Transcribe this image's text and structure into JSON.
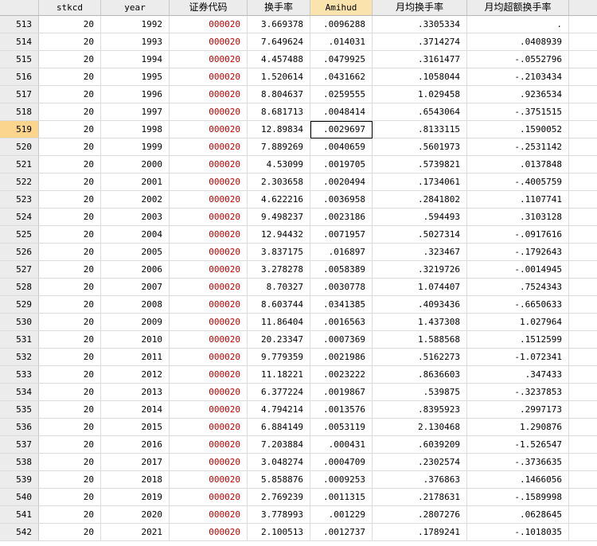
{
  "columns": [
    "stkcd",
    "year",
    "证券代码",
    "换手率",
    "Amihud",
    "月均换手率",
    "月均超额换手率"
  ],
  "selected_column": 4,
  "current_row": "519",
  "rows": [
    {
      "n": "513",
      "stkcd": "20",
      "year": "1992",
      "code": "000020",
      "turnover": "3.669378",
      "amihud": ".0096288",
      "mturn": ".3305334",
      "mexcess": "."
    },
    {
      "n": "514",
      "stkcd": "20",
      "year": "1993",
      "code": "000020",
      "turnover": "7.649624",
      "amihud": ".014031",
      "mturn": ".3714274",
      "mexcess": ".0408939"
    },
    {
      "n": "515",
      "stkcd": "20",
      "year": "1994",
      "code": "000020",
      "turnover": "4.457488",
      "amihud": ".0479925",
      "mturn": ".3161477",
      "mexcess": "-.0552796"
    },
    {
      "n": "516",
      "stkcd": "20",
      "year": "1995",
      "code": "000020",
      "turnover": "1.520614",
      "amihud": ".0431662",
      "mturn": ".1058044",
      "mexcess": "-.2103434"
    },
    {
      "n": "517",
      "stkcd": "20",
      "year": "1996",
      "code": "000020",
      "turnover": "8.804637",
      "amihud": ".0259555",
      "mturn": "1.029458",
      "mexcess": ".9236534"
    },
    {
      "n": "518",
      "stkcd": "20",
      "year": "1997",
      "code": "000020",
      "turnover": "8.681713",
      "amihud": ".0048414",
      "mturn": ".6543064",
      "mexcess": "-.3751515"
    },
    {
      "n": "519",
      "stkcd": "20",
      "year": "1998",
      "code": "000020",
      "turnover": "12.89834",
      "amihud": ".0029697",
      "mturn": ".8133115",
      "mexcess": ".1590052"
    },
    {
      "n": "520",
      "stkcd": "20",
      "year": "1999",
      "code": "000020",
      "turnover": "7.889269",
      "amihud": ".0040659",
      "mturn": ".5601973",
      "mexcess": "-.2531142"
    },
    {
      "n": "521",
      "stkcd": "20",
      "year": "2000",
      "code": "000020",
      "turnover": "4.53099",
      "amihud": ".0019705",
      "mturn": ".5739821",
      "mexcess": ".0137848"
    },
    {
      "n": "522",
      "stkcd": "20",
      "year": "2001",
      "code": "000020",
      "turnover": "2.303658",
      "amihud": ".0020494",
      "mturn": ".1734061",
      "mexcess": "-.4005759"
    },
    {
      "n": "523",
      "stkcd": "20",
      "year": "2002",
      "code": "000020",
      "turnover": "4.622216",
      "amihud": ".0036958",
      "mturn": ".2841802",
      "mexcess": ".1107741"
    },
    {
      "n": "524",
      "stkcd": "20",
      "year": "2003",
      "code": "000020",
      "turnover": "9.498237",
      "amihud": ".0023186",
      "mturn": ".594493",
      "mexcess": ".3103128"
    },
    {
      "n": "525",
      "stkcd": "20",
      "year": "2004",
      "code": "000020",
      "turnover": "12.94432",
      "amihud": ".0071957",
      "mturn": ".5027314",
      "mexcess": "-.0917616"
    },
    {
      "n": "526",
      "stkcd": "20",
      "year": "2005",
      "code": "000020",
      "turnover": "3.837175",
      "amihud": ".016897",
      "mturn": ".323467",
      "mexcess": "-.1792643"
    },
    {
      "n": "527",
      "stkcd": "20",
      "year": "2006",
      "code": "000020",
      "turnover": "3.278278",
      "amihud": ".0058389",
      "mturn": ".3219726",
      "mexcess": "-.0014945"
    },
    {
      "n": "528",
      "stkcd": "20",
      "year": "2007",
      "code": "000020",
      "turnover": "8.70327",
      "amihud": ".0030778",
      "mturn": "1.074407",
      "mexcess": ".7524343"
    },
    {
      "n": "529",
      "stkcd": "20",
      "year": "2008",
      "code": "000020",
      "turnover": "8.603744",
      "amihud": ".0341385",
      "mturn": ".4093436",
      "mexcess": "-.6650633"
    },
    {
      "n": "530",
      "stkcd": "20",
      "year": "2009",
      "code": "000020",
      "turnover": "11.86404",
      "amihud": ".0016563",
      "mturn": "1.437308",
      "mexcess": "1.027964"
    },
    {
      "n": "531",
      "stkcd": "20",
      "year": "2010",
      "code": "000020",
      "turnover": "20.23347",
      "amihud": ".0007369",
      "mturn": "1.588568",
      "mexcess": ".1512599"
    },
    {
      "n": "532",
      "stkcd": "20",
      "year": "2011",
      "code": "000020",
      "turnover": "9.779359",
      "amihud": ".0021986",
      "mturn": ".5162273",
      "mexcess": "-1.072341"
    },
    {
      "n": "533",
      "stkcd": "20",
      "year": "2012",
      "code": "000020",
      "turnover": "11.18221",
      "amihud": ".0023222",
      "mturn": ".8636603",
      "mexcess": ".347433"
    },
    {
      "n": "534",
      "stkcd": "20",
      "year": "2013",
      "code": "000020",
      "turnover": "6.377224",
      "amihud": ".0019867",
      "mturn": ".539875",
      "mexcess": "-.3237853"
    },
    {
      "n": "535",
      "stkcd": "20",
      "year": "2014",
      "code": "000020",
      "turnover": "4.794214",
      "amihud": ".0013576",
      "mturn": ".8395923",
      "mexcess": ".2997173"
    },
    {
      "n": "536",
      "stkcd": "20",
      "year": "2015",
      "code": "000020",
      "turnover": "6.884149",
      "amihud": ".0053119",
      "mturn": "2.130468",
      "mexcess": "1.290876"
    },
    {
      "n": "537",
      "stkcd": "20",
      "year": "2016",
      "code": "000020",
      "turnover": "7.203884",
      "amihud": ".000431",
      "mturn": ".6039209",
      "mexcess": "-1.526547"
    },
    {
      "n": "538",
      "stkcd": "20",
      "year": "2017",
      "code": "000020",
      "turnover": "3.048274",
      "amihud": ".0004709",
      "mturn": ".2302574",
      "mexcess": "-.3736635"
    },
    {
      "n": "539",
      "stkcd": "20",
      "year": "2018",
      "code": "000020",
      "turnover": "5.858876",
      "amihud": ".0009253",
      "mturn": ".376863",
      "mexcess": ".1466056"
    },
    {
      "n": "540",
      "stkcd": "20",
      "year": "2019",
      "code": "000020",
      "turnover": "2.769239",
      "amihud": ".0011315",
      "mturn": ".2178631",
      "mexcess": "-.1589998"
    },
    {
      "n": "541",
      "stkcd": "20",
      "year": "2020",
      "code": "000020",
      "turnover": "3.778993",
      "amihud": ".001229",
      "mturn": ".2807276",
      "mexcess": ".0628645"
    },
    {
      "n": "542",
      "stkcd": "20",
      "year": "2021",
      "code": "000020",
      "turnover": "2.100513",
      "amihud": ".0012737",
      "mturn": ".1789241",
      "mexcess": "-.1018035"
    }
  ],
  "colors": {
    "code_text": "#c00000",
    "selected_header": "#fbe3ad",
    "current_row_number": "#fbd48d"
  }
}
